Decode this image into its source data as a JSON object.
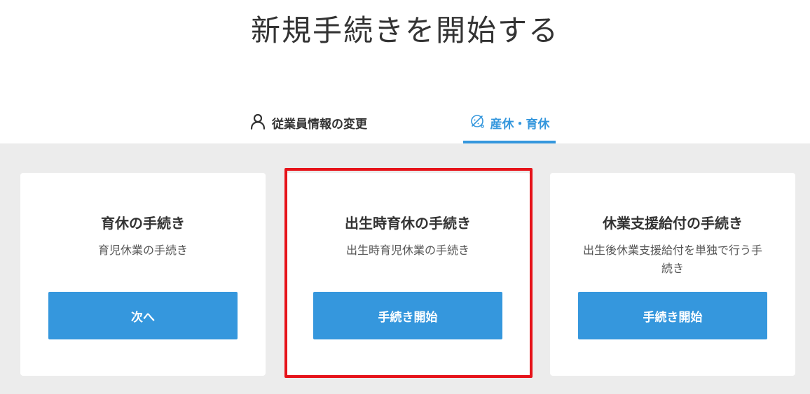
{
  "page": {
    "title": "新規手続きを開始する"
  },
  "tabs": [
    {
      "label": "従業員情報の変更",
      "icon": "person-icon",
      "active": false
    },
    {
      "label": "産休・育休",
      "icon": "baby-icon",
      "active": true
    }
  ],
  "cards": [
    {
      "title": "育休の手続き",
      "description": "育児休業の手続き",
      "button_label": "次へ"
    },
    {
      "title": "出生時育休の手続き",
      "description": "出生時育児休業の手続き",
      "button_label": "手続き開始"
    },
    {
      "title": "休業支援給付の手続き",
      "description": "出生後休業支援給付を単独で行う手続き",
      "button_label": "手続き開始"
    }
  ],
  "colors": {
    "accent": "#3597dd",
    "highlight": "#e6131a",
    "content_background": "#ececec"
  }
}
